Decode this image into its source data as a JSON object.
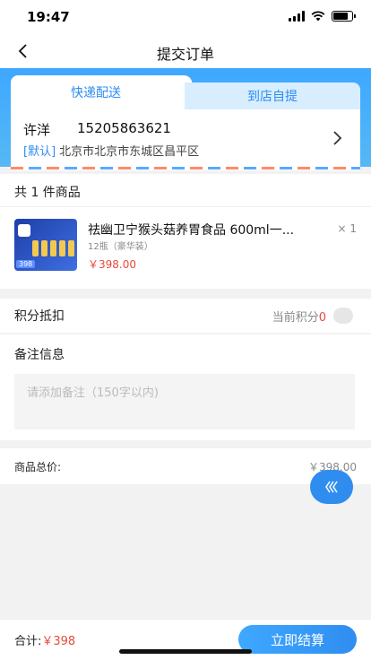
{
  "status": {
    "time": "19:47",
    "battery_level": 0.8
  },
  "nav": {
    "title": "提交订单"
  },
  "delivery_tabs": [
    {
      "label": "快递配送",
      "active": true
    },
    {
      "label": "到店自提",
      "active": false
    }
  ],
  "address": {
    "name": "许洋",
    "phone": "15205863621",
    "tag": "[默认]",
    "detail": "北京市北京市东城区昌平区"
  },
  "goods": {
    "count_label": "共 1 件商品",
    "items": [
      {
        "title": "祛幽卫宁猴头菇养胃食品 600ml一...",
        "spec": "12瓶（豪华装）",
        "price": "￥398.00",
        "qty": "× 1",
        "thumb_price": "398"
      }
    ]
  },
  "points": {
    "label": "积分抵扣",
    "current_label": "当前积分",
    "current_value": "0",
    "enabled": false
  },
  "remark": {
    "label": "备注信息",
    "placeholder": "请添加备注（150字以内)"
  },
  "total": {
    "label": "商品总价:",
    "value": "￥398.00"
  },
  "footer": {
    "sum_label": "合计:",
    "sum_value": "￥398",
    "checkout_label": "立即结算"
  },
  "colors": {
    "accent": "#2f8df0",
    "price": "#e84a3b"
  }
}
